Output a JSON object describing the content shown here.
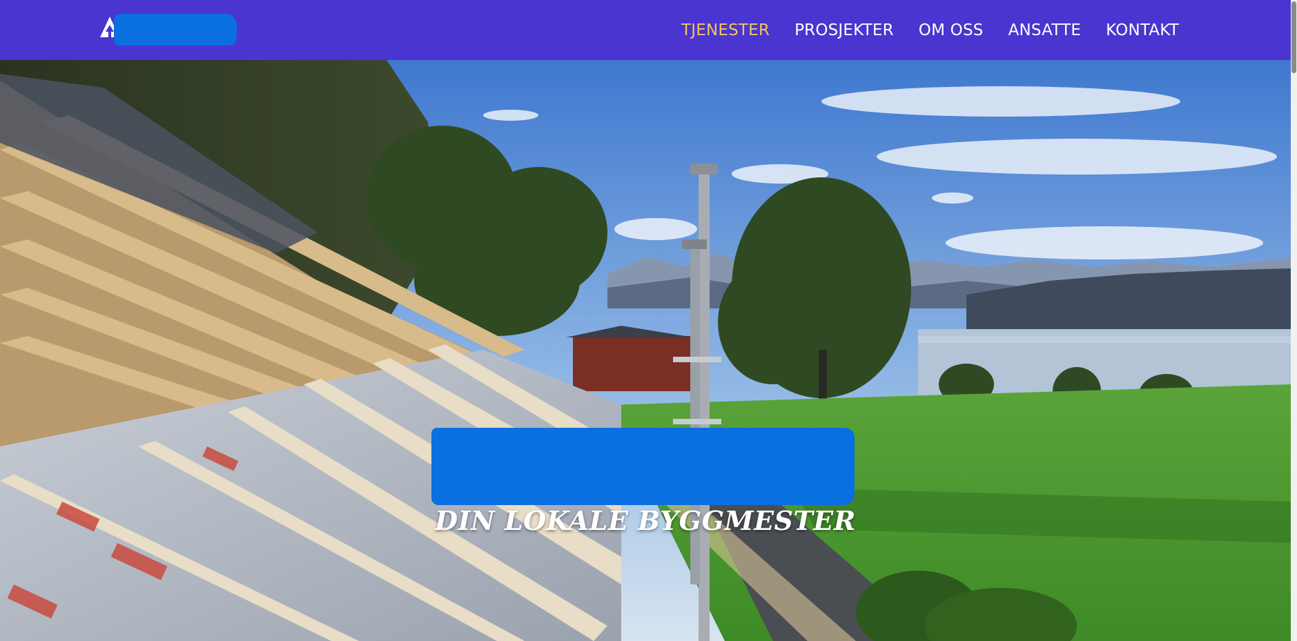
{
  "nav": {
    "items": [
      {
        "label": "TJENESTER",
        "active": true
      },
      {
        "label": "PROSJEKTER",
        "active": false
      },
      {
        "label": "OM OSS",
        "active": false
      },
      {
        "label": "ANSATTE",
        "active": false
      },
      {
        "label": "KONTAKT",
        "active": false
      }
    ],
    "active_color": "#f2c75a",
    "background_color": "#4a35d0"
  },
  "hero": {
    "tagline": "DIN LOKALE BYGGMESTER"
  },
  "icons": {
    "logo": "triangle-tree-logo-icon"
  },
  "colors": {
    "brand": "#4a35d0",
    "redaction": "#0a6fe0"
  }
}
